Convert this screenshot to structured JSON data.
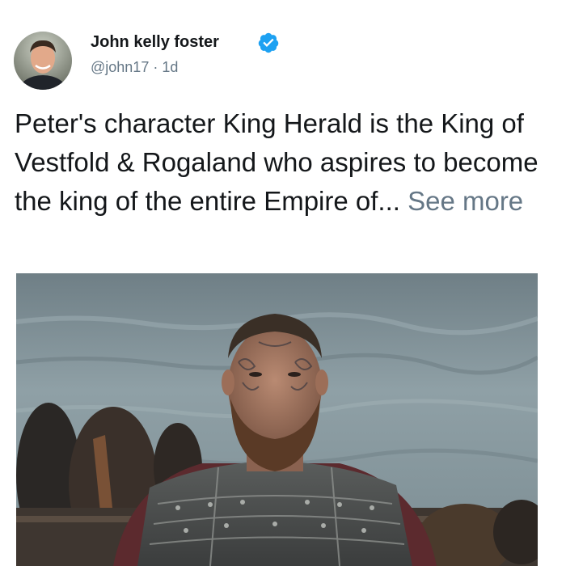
{
  "post": {
    "author": {
      "display_name": "John kelly foster",
      "handle": "@john17",
      "verified_icon": "verified-badge-icon",
      "avatar_icon": "avatar-photo"
    },
    "time_separator": "·",
    "timestamp": "1d",
    "text": "Peter's character King Herald is the King of Vestfold & Rogaland who aspires to become the king of the entire Empire of...",
    "see_more_label": "See more",
    "image": {
      "content": "bearded-warrior-photo"
    }
  },
  "colors": {
    "primary_text": "#14171a",
    "secondary_text": "#657786",
    "verified_blue": "#1da1f2",
    "background": "#ffffff"
  }
}
